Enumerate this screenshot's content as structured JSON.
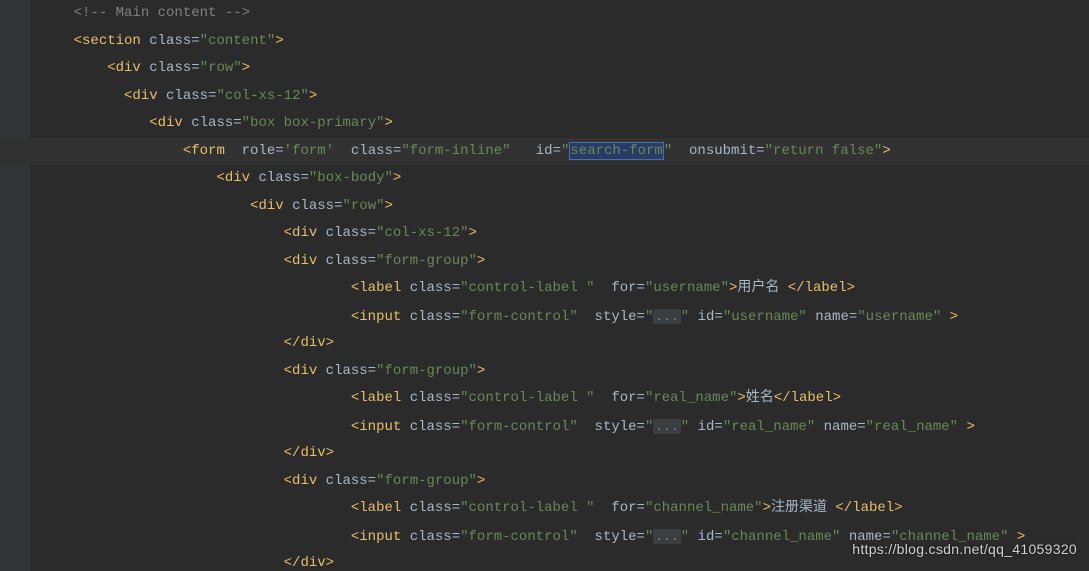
{
  "watermark": "https://blog.csdn.net/qq_41059320",
  "lines": {
    "l1": {
      "indent": 4,
      "raw": "<!-- Main content -->"
    },
    "l2": {
      "indent": 4,
      "tag_open": "section",
      "attrs": [
        {
          "name": "class",
          "val": "content"
        }
      ],
      "self_close": false
    },
    "l3": {
      "indent": 8,
      "tag_open": "div",
      "attrs": [
        {
          "name": "class",
          "val": "row"
        }
      ]
    },
    "l4": {
      "indent": 10,
      "tag_open": "div",
      "attrs": [
        {
          "name": "class",
          "val": "col-xs-12"
        }
      ]
    },
    "l5": {
      "indent": 13,
      "tag_open": "div",
      "attrs": [
        {
          "name": "class",
          "val": "box box-primary"
        }
      ]
    },
    "l6": {
      "indent": 17,
      "tag_open": "form",
      "attrs": [
        {
          "name": "role",
          "val": "form",
          "q": "'",
          "sp_before": 2
        },
        {
          "name": "class",
          "val": "form-inline",
          "sp_before": 2
        },
        {
          "name": "id",
          "val_pre": "",
          "val_sel": "search-form",
          "val_post": "",
          "sp_before": 3
        },
        {
          "name": "onsubmit",
          "val": "return false",
          "sp_before": 2
        }
      ],
      "highlight": true
    },
    "l7": {
      "indent": 21,
      "tag_open": "div",
      "attrs": [
        {
          "name": "class",
          "val": "box-body"
        }
      ]
    },
    "l8": {
      "indent": 25,
      "tag_open": "div",
      "attrs": [
        {
          "name": "class",
          "val": "row"
        }
      ]
    },
    "l9": {
      "indent": 29,
      "tag_open": "div",
      "attrs": [
        {
          "name": "class",
          "val": "col-xs-12"
        }
      ]
    },
    "l10": {
      "indent": 29,
      "tag_open": "div",
      "attrs": [
        {
          "name": "class",
          "val": "form-group"
        }
      ]
    },
    "l11": {
      "indent": 37,
      "tag_open": "label",
      "attrs": [
        {
          "name": "class",
          "val": "control-label "
        },
        {
          "name": "for",
          "val": "username",
          "sp_before": 2
        }
      ],
      "inner_text": "用户名 ",
      "close_same_line": "label"
    },
    "l12": {
      "indent": 37,
      "tag_open": "input",
      "attrs": [
        {
          "name": "class",
          "val": "form-control"
        },
        {
          "name": "style",
          "fold": "...",
          "sp_before": 2
        },
        {
          "name": "id",
          "val": "username"
        },
        {
          "name": "name",
          "val": "username"
        }
      ],
      "trailing_space_close": true
    },
    "l13": {
      "indent": 29,
      "tag_close": "div"
    },
    "l14": {
      "indent": 29,
      "tag_open": "div",
      "attrs": [
        {
          "name": "class",
          "val": "form-group"
        }
      ]
    },
    "l15": {
      "indent": 37,
      "tag_open": "label",
      "attrs": [
        {
          "name": "class",
          "val": "control-label "
        },
        {
          "name": "for",
          "val": "real_name",
          "sp_before": 2
        }
      ],
      "inner_text": "姓名",
      "close_same_line": "label"
    },
    "l16": {
      "indent": 37,
      "tag_open": "input",
      "attrs": [
        {
          "name": "class",
          "val": "form-control"
        },
        {
          "name": "style",
          "fold": "...",
          "sp_before": 2
        },
        {
          "name": "id",
          "val": "real_name"
        },
        {
          "name": "name",
          "val": "real_name"
        }
      ],
      "trailing_space_close": true
    },
    "l17": {
      "indent": 29,
      "tag_close": "div"
    },
    "l18": {
      "indent": 29,
      "tag_open": "div",
      "attrs": [
        {
          "name": "class",
          "val": "form-group"
        }
      ]
    },
    "l19": {
      "indent": 37,
      "tag_open": "label",
      "attrs": [
        {
          "name": "class",
          "val": "control-label "
        },
        {
          "name": "for",
          "val": "channel_name",
          "sp_before": 2
        }
      ],
      "inner_text": "注册渠道 ",
      "close_same_line": "label"
    },
    "l20": {
      "indent": 37,
      "tag_open": "input",
      "attrs": [
        {
          "name": "class",
          "val": "form-control"
        },
        {
          "name": "style",
          "fold": "...",
          "sp_before": 2
        },
        {
          "name": "id",
          "val": "channel_name"
        },
        {
          "name": "name",
          "val": "channel_name"
        }
      ],
      "trailing_space_close": true
    },
    "l21": {
      "indent": 29,
      "tag_close": "div"
    }
  }
}
